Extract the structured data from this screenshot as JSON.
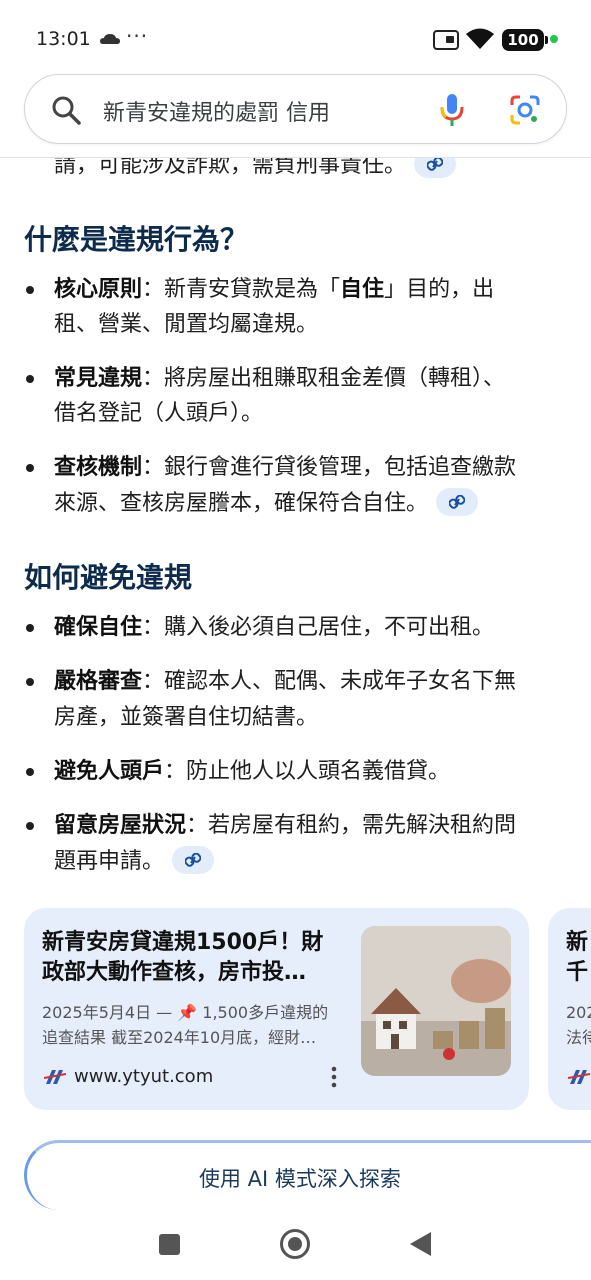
{
  "status_bar": {
    "time": "13:01",
    "more": "···",
    "battery": "100"
  },
  "search": {
    "query": "新青安違規的處罰 信用"
  },
  "content": {
    "top_line": "請，可能涉及詐欺，需負刑事責任。",
    "section1": {
      "heading": "什麼是違規行為？",
      "items": [
        {
          "label": "核心原則",
          "colon": "：",
          "line1_a": "新青安貸款是為「",
          "line1_bold": "自住",
          "line1_b": "」目的，出",
          "line2": "租、營業、閒置均屬違規。"
        },
        {
          "label": "常見違規",
          "colon": "：",
          "line1": "將房屋出租賺取租金差價（轉租）、",
          "line2": "借名登記（人頭戶）。"
        },
        {
          "label": "查核機制",
          "colon": "：",
          "line1": "銀行會進行貸後管理，包括追查繳款",
          "line2": "來源、查核房屋謄本，確保符合自住。"
        }
      ]
    },
    "section2": {
      "heading": "如何避免違規",
      "items": [
        {
          "label": "確保自住",
          "colon": "：",
          "line1": "購入後必須自己居住，不可出租。"
        },
        {
          "label": "嚴格審查",
          "colon": "：",
          "line1": "確認本人、配偶、未成年子女名下無",
          "line2": "房產，並簽署自住切結書。"
        },
        {
          "label": "避免人頭戶",
          "colon": "：",
          "line1": "防止他人以人頭名義借貸。"
        },
        {
          "label": "留意房屋狀況",
          "colon": "：",
          "line1": "若房屋有租約，需先解決租約問",
          "line2": "題再申請。"
        }
      ]
    },
    "cards": [
      {
        "title_l1": "新青安房貸違規1500戶！財",
        "title_l2": "政部大動作查核，房市投…",
        "snip_l1": "2025年5月4日 — 📌 1,500多戶違規的",
        "snip_l2": "追查結果 截至2024年10月底，經財…",
        "domain": "www.ytyut.com"
      },
      {
        "title_l1": "新",
        "title_l2": "千",
        "snip_l1": "202",
        "snip_l2": "法待"
      }
    ],
    "ai_mode_button": "使用 AI 模式深入探索"
  },
  "colors": {
    "heading": "#0d2b4d",
    "card_bg": "#e6edfb",
    "chip_bg": "#e3ecfa"
  }
}
